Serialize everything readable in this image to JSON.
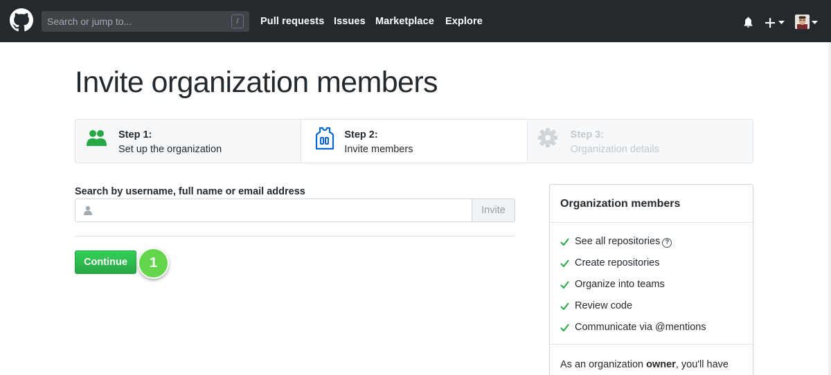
{
  "header": {
    "search_placeholder": "Search or jump to...",
    "search_shortcut": "/",
    "nav": [
      "Pull requests",
      "Issues",
      "Marketplace",
      "Explore"
    ]
  },
  "page": {
    "title": "Invite organization members"
  },
  "steps": [
    {
      "title": "Step 1:",
      "subtitle": "Set up the organization",
      "icon": "people-icon",
      "state": "done"
    },
    {
      "title": "Step 2:",
      "subtitle": "Invite members",
      "icon": "jersey-icon",
      "state": "current"
    },
    {
      "title": "Step 3:",
      "subtitle": "Organization details",
      "icon": "gear-icon",
      "state": "future"
    }
  ],
  "form": {
    "label": "Search by username, full name or email address",
    "input_value": "",
    "invite_label": "Invite",
    "continue_label": "Continue",
    "marker": "1"
  },
  "panel": {
    "title": "Organization members",
    "permissions": [
      "See all repositories",
      "Create repositories",
      "Organize into teams",
      "Review code",
      "Communicate via @mentions"
    ],
    "help_glyph": "?",
    "footer_prefix": "As an organization ",
    "footer_bold": "owner",
    "footer_suffix": ", you'll have"
  },
  "colors": {
    "header_bg": "#24292e",
    "green": "#28a745",
    "blue": "#0366d6",
    "marker": "#63d64b"
  }
}
